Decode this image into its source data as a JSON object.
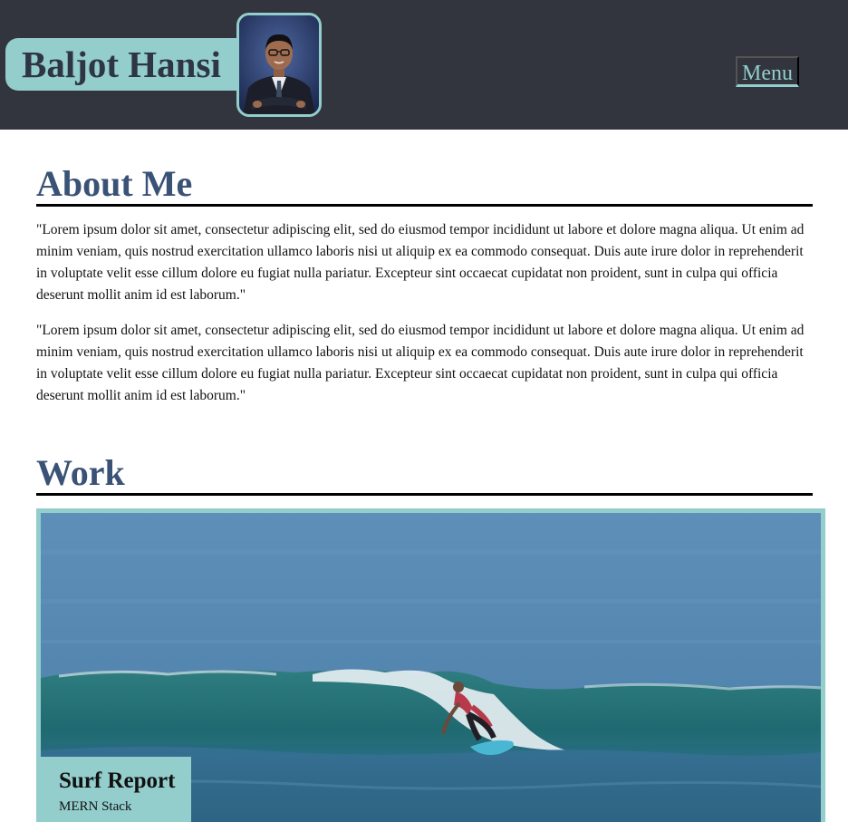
{
  "header": {
    "name": "Baljot Hansi",
    "menu_label": "Menu",
    "colors": {
      "background": "#32353d",
      "accent": "#93cdcc",
      "name_text": "#2e3544"
    }
  },
  "about": {
    "title": "About Me",
    "paragraphs": [
      "\"Lorem ipsum dolor sit amet, consectetur adipiscing elit, sed do eiusmod tempor incididunt ut labore et dolore magna aliqua. Ut enim ad minim veniam, quis nostrud exercitation ullamco laboris nisi ut aliquip ex ea commodo consequat. Duis aute irure dolor in reprehenderit in voluptate velit esse cillum dolore eu fugiat nulla pariatur. Excepteur sint occaecat cupidatat non proident, sunt in culpa qui officia deserunt mollit anim id est laborum.\"",
      "\"Lorem ipsum dolor sit amet, consectetur adipiscing elit, sed do eiusmod tempor incididunt ut labore et dolore magna aliqua. Ut enim ad minim veniam, quis nostrud exercitation ullamco laboris nisi ut aliquip ex ea commodo consequat. Duis aute irure dolor in reprehenderit in voluptate velit esse cillum dolore eu fugiat nulla pariatur. Excepteur sint occaecat cupidatat non proident, sunt in culpa qui officia deserunt mollit anim id est laborum.\""
    ]
  },
  "work": {
    "title": "Work",
    "projects": [
      {
        "title": "Surf Report",
        "subtitle": "MERN Stack"
      }
    ]
  },
  "colors": {
    "heading": "#3a5276",
    "rule": "#000000"
  }
}
